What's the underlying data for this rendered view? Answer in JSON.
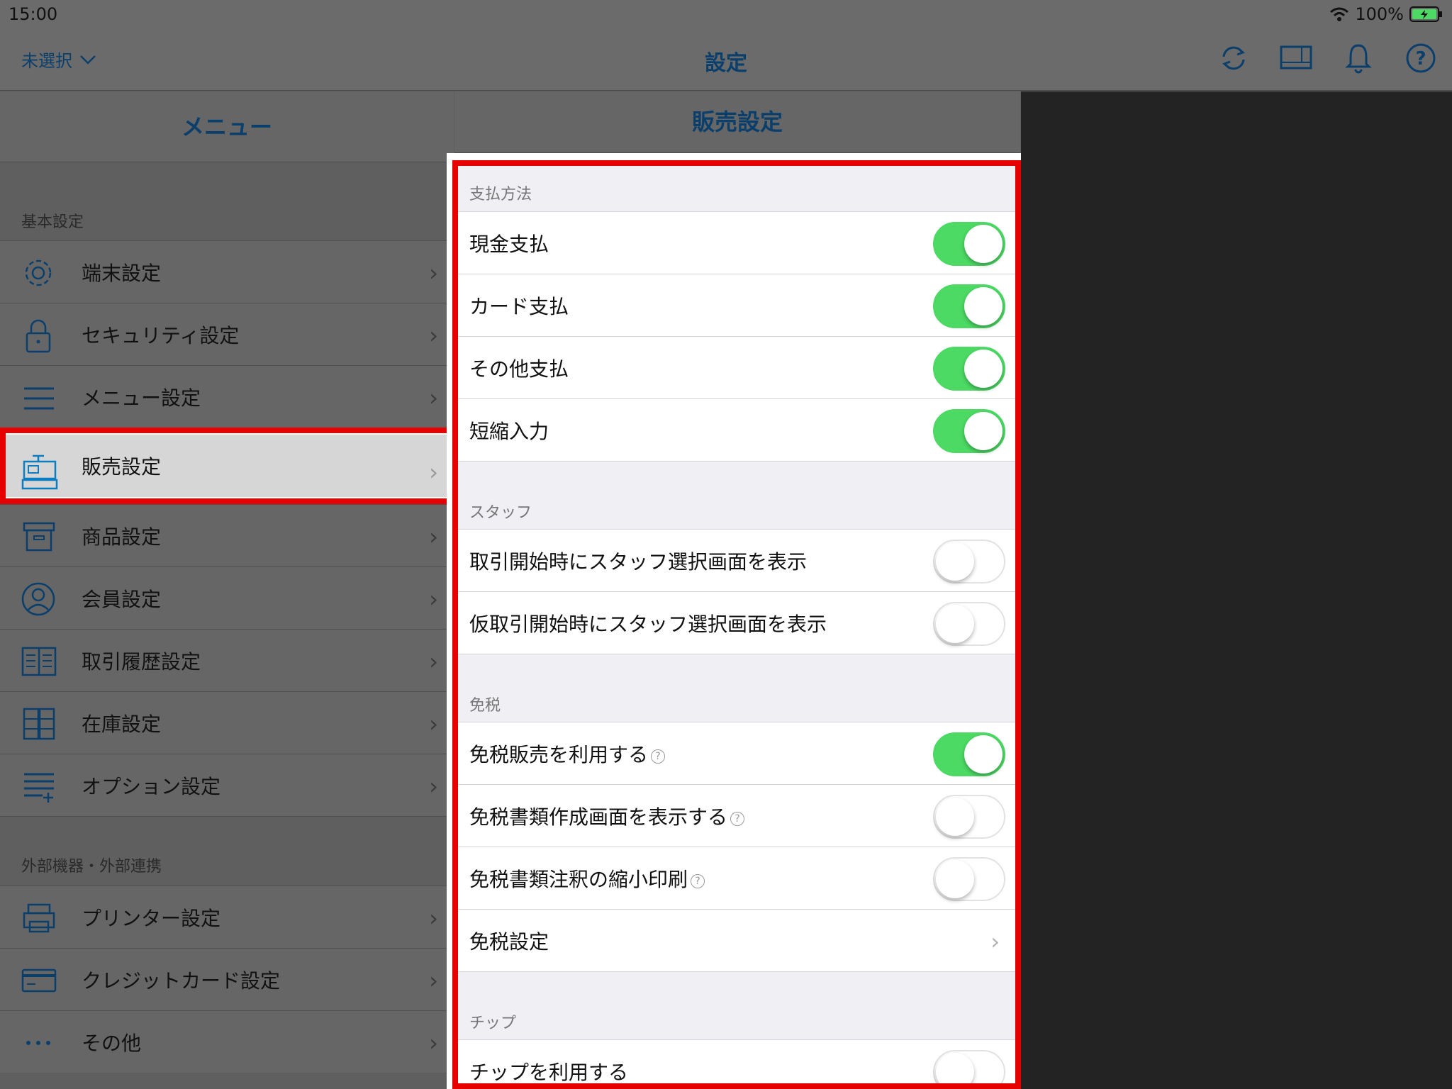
{
  "status_bar": {
    "time": "15:00",
    "battery": "100%"
  },
  "nav": {
    "store_label": "未選択",
    "title": "設定"
  },
  "menu": {
    "header": "メニュー",
    "section1": "基本設定",
    "items1": [
      {
        "label": "端末設定",
        "icon": "gear-icon"
      },
      {
        "label": "セキュリティ設定",
        "icon": "lock-icon"
      },
      {
        "label": "メニュー設定",
        "icon": "list-icon"
      },
      {
        "label": "販売設定",
        "icon": "register-icon"
      },
      {
        "label": "商品設定",
        "icon": "box-icon"
      },
      {
        "label": "会員設定",
        "icon": "person-icon"
      },
      {
        "label": "取引履歴設定",
        "icon": "book-icon"
      },
      {
        "label": "在庫設定",
        "icon": "cabinet-icon"
      },
      {
        "label": "オプション設定",
        "icon": "list-plus-icon"
      }
    ],
    "section2": "外部機器・外部連携",
    "items2": [
      {
        "label": "プリンター設定",
        "icon": "printer-icon"
      },
      {
        "label": "クレジットカード設定",
        "icon": "card-icon"
      },
      {
        "label": "その他",
        "icon": "more-icon"
      }
    ]
  },
  "panel": {
    "header": "販売設定",
    "groups": [
      {
        "title": "支払方法",
        "rows": [
          {
            "label": "現金支払",
            "on": true
          },
          {
            "label": "カード支払",
            "on": true
          },
          {
            "label": "その他支払",
            "on": true
          },
          {
            "label": "短縮入力",
            "on": true
          }
        ]
      },
      {
        "title": "スタッフ",
        "rows": [
          {
            "label": "取引開始時にスタッフ選択画面を表示",
            "on": false
          },
          {
            "label": "仮取引開始時にスタッフ選択画面を表示",
            "on": false
          }
        ]
      },
      {
        "title": "免税",
        "rows": [
          {
            "label": "免税販売を利用する",
            "on": true,
            "help": true
          },
          {
            "label": "免税書類作成画面を表示する",
            "on": false,
            "help": true
          },
          {
            "label": "免税書類注釈の縮小印刷",
            "on": false,
            "help": true
          },
          {
            "label": "免税設定",
            "nav": true
          }
        ]
      },
      {
        "title": "チップ",
        "rows": [
          {
            "label": "チップを利用する",
            "on": false
          }
        ]
      }
    ]
  },
  "colors": {
    "accent": "#0b3f6b",
    "toggle_on": "#4cd964",
    "highlight": "#e60000"
  }
}
